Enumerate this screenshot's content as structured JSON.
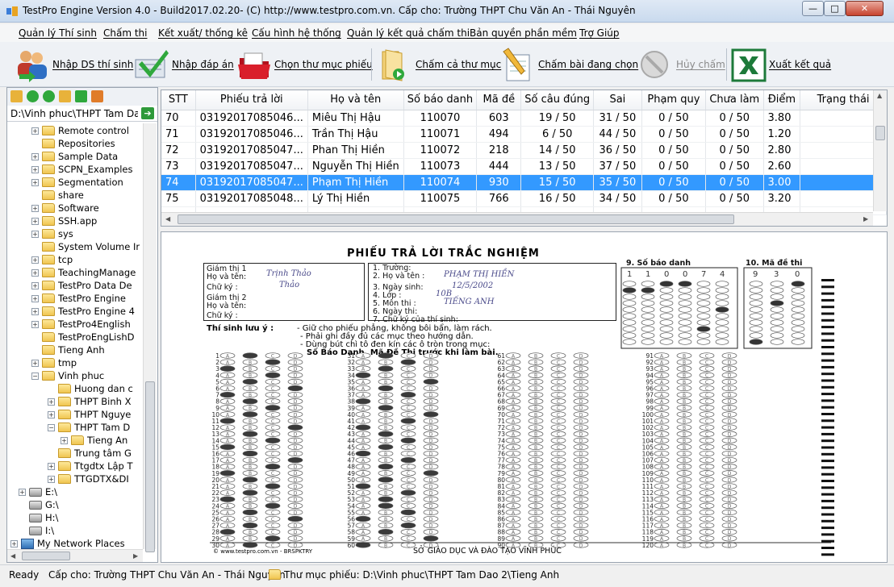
{
  "window": {
    "title": "TestPro Engine Version 4.0 - Build2017.02.20- (C) http://www.testpro.com.vn.  Cấp cho: Trường THPT Chu Văn An - Thái Nguyên",
    "minimize": "—",
    "maximize": "□",
    "close": "✕"
  },
  "menu": [
    "Quản lý Thí sinh",
    "Chấm thi",
    "Kết xuất/ thống kê",
    "Cấu hình hệ thống",
    "Quản lý kết quả chấm thi",
    "Bản quyền phần mềm",
    "Trợ Giúp"
  ],
  "toolbar": [
    {
      "label": "Nhập DS thí sinh",
      "icon": "users-import-icon",
      "enabled": true
    },
    {
      "label": "Nhập đáp án",
      "icon": "checkmark-document-icon",
      "enabled": true
    },
    {
      "label": "Chọn thư mục phiếu",
      "icon": "red-folder-icon",
      "enabled": true
    },
    {
      "label": "Chấm cả thư mục",
      "icon": "folder-play-icon",
      "enabled": true
    },
    {
      "label": "Chấm bài đang chọn",
      "icon": "pencil-sheet-icon",
      "enabled": true
    },
    {
      "label": "Hủy chấm",
      "icon": "cancel-icon",
      "enabled": false
    },
    {
      "label": "Xuất kết quả",
      "icon": "excel-icon",
      "enabled": true
    }
  ],
  "explorer": {
    "path": "D:\\Vinh phuc\\THPT Tam Dao 2",
    "go_label": "➔",
    "tree": [
      {
        "label": "Remote control",
        "level": 1,
        "exp": "+",
        "type": "folder"
      },
      {
        "label": "Repositories",
        "level": 1,
        "exp": "",
        "type": "folder"
      },
      {
        "label": "Sample Data",
        "level": 1,
        "exp": "+",
        "type": "folder"
      },
      {
        "label": "SCPN_Examples",
        "level": 1,
        "exp": "+",
        "type": "folder"
      },
      {
        "label": "Segmentation",
        "level": 1,
        "exp": "+",
        "type": "folder"
      },
      {
        "label": "share",
        "level": 1,
        "exp": "",
        "type": "folder"
      },
      {
        "label": "Software",
        "level": 1,
        "exp": "+",
        "type": "folder"
      },
      {
        "label": "SSH.app",
        "level": 1,
        "exp": "+",
        "type": "folder"
      },
      {
        "label": "sys",
        "level": 1,
        "exp": "+",
        "type": "folder"
      },
      {
        "label": "System Volume Ir",
        "level": 1,
        "exp": "",
        "type": "folder"
      },
      {
        "label": "tcp",
        "level": 1,
        "exp": "+",
        "type": "folder"
      },
      {
        "label": "TeachingManage",
        "level": 1,
        "exp": "+",
        "type": "folder"
      },
      {
        "label": "TestPro Data De",
        "level": 1,
        "exp": "+",
        "type": "folder"
      },
      {
        "label": "TestPro Engine",
        "level": 1,
        "exp": "+",
        "type": "folder"
      },
      {
        "label": "TestPro Engine 4",
        "level": 1,
        "exp": "+",
        "type": "folder"
      },
      {
        "label": "TestPro4English",
        "level": 1,
        "exp": "+",
        "type": "folder"
      },
      {
        "label": "TestProEngLishD",
        "level": 1,
        "exp": "",
        "type": "folder"
      },
      {
        "label": "Tieng Anh",
        "level": 1,
        "exp": "",
        "type": "folder"
      },
      {
        "label": "tmp",
        "level": 1,
        "exp": "+",
        "type": "folder"
      },
      {
        "label": "Vinh phuc",
        "level": 1,
        "exp": "−",
        "type": "folder"
      },
      {
        "label": "Huong dan c",
        "level": 2,
        "exp": "",
        "type": "folder"
      },
      {
        "label": "THPT Binh X",
        "level": 2,
        "exp": "+",
        "type": "folder"
      },
      {
        "label": "THPT Nguye",
        "level": 2,
        "exp": "+",
        "type": "folder"
      },
      {
        "label": "THPT Tam D",
        "level": 2,
        "exp": "−",
        "type": "folder"
      },
      {
        "label": "Tieng An",
        "level": 3,
        "exp": "+",
        "type": "folder"
      },
      {
        "label": "Trung tâm G",
        "level": 2,
        "exp": "",
        "type": "folder"
      },
      {
        "label": "Ttgdtx Lập T",
        "level": 2,
        "exp": "+",
        "type": "folder"
      },
      {
        "label": "TTGDTX&DI",
        "level": 2,
        "exp": "+",
        "type": "folder"
      },
      {
        "label": "E:\\",
        "level": 0,
        "exp": "+",
        "type": "drive"
      },
      {
        "label": "G:\\",
        "level": 0,
        "exp": "",
        "type": "drive"
      },
      {
        "label": "H:\\",
        "level": 0,
        "exp": "",
        "type": "drive"
      },
      {
        "label": "I:\\",
        "level": 0,
        "exp": "",
        "type": "drive"
      },
      {
        "label": "My Network Places",
        "level": -1,
        "exp": "+",
        "type": "network"
      }
    ]
  },
  "results": {
    "columns": [
      "STT",
      "Phiếu trả lời",
      "Họ và tên",
      "Số báo danh",
      "Mã đề",
      "Số câu đúng",
      "Sai",
      "Phạm quy",
      "Chưa làm",
      "Điểm",
      "Trạng thái"
    ],
    "rows": [
      [
        "70",
        "03192017085046...",
        "Miêu Thị Hậu",
        "110070",
        "603",
        "19 / 50",
        "31 / 50",
        "0 / 50",
        "0 / 50",
        "3.80",
        ""
      ],
      [
        "71",
        "03192017085046...",
        "Trần Thị Hậu",
        "110071",
        "494",
        "6 / 50",
        "44 / 50",
        "0 / 50",
        "0 / 50",
        "1.20",
        ""
      ],
      [
        "72",
        "03192017085047...",
        "Phan Thị Hiền",
        "110072",
        "218",
        "14 / 50",
        "36 / 50",
        "0 / 50",
        "0 / 50",
        "2.80",
        ""
      ],
      [
        "73",
        "03192017085047...",
        "Nguyễn Thị Hiền",
        "110073",
        "444",
        "13 / 50",
        "37 / 50",
        "0 / 50",
        "0 / 50",
        "2.60",
        ""
      ],
      [
        "74",
        "03192017085047...",
        "Phạm Thị Hiền",
        "110074",
        "930",
        "15 / 50",
        "35 / 50",
        "0 / 50",
        "0 / 50",
        "3.00",
        ""
      ],
      [
        "75",
        "03192017085048...",
        "Lý Thị Hiền",
        "110075",
        "766",
        "16 / 50",
        "34 / 50",
        "0 / 50",
        "0 / 50",
        "3.20",
        ""
      ]
    ],
    "selected_index": 4
  },
  "sheet": {
    "title": "PHIẾU TRẢ LỜI TRẮC NGHIỆM",
    "sbd_label": "9. Số báo danh",
    "made_label": "10. Mã đề thi",
    "sbd_digits": [
      "1",
      "1",
      "0",
      "0",
      "7",
      "4"
    ],
    "made_digits": [
      "9",
      "3",
      "0"
    ],
    "left_box": {
      "gt1": "Giám thị 1",
      "gt1_name": "Họ và tên:",
      "gt1_sign": "Chữ ký :",
      "gt2": "Giám thị 2",
      "gt2_name": "Họ và tên:",
      "gt2_sign": "Chữ ký :",
      "gt1_hand": "Trịnh Thảo",
      "gt1_sign_hand": "Thảo"
    },
    "mid_box": {
      "l1": "1. Trường:",
      "l2": "2. Họ và tên :",
      "l3": "3. Ngày sinh:",
      "l4": "4. Lớp :",
      "l5": "5. Môn thi :",
      "l6": "6. Ngày thi:",
      "l7": "7. Chữ ký của thí sinh:",
      "name_hand": "PHẠM  THỊ  HIỀN",
      "dob_hand": "12/5/2002",
      "class_hand": "10B",
      "subject_hand": "TIẾNG  ANH"
    },
    "notes": {
      "label": "Thí sinh lưu ý :",
      "n1": "- Giữ cho phiếu phẳng, không bôi bẩn, làm rách.",
      "n2": "- Phải ghi đầy đủ các mục theo hướng dẫn.",
      "n3": "- Dùng bút chì tô đen kín các ô tròn trong mục:",
      "n4": "Số Báo Danh, Mã Đề Thi trước khi làm bài."
    },
    "option_letters": [
      "A",
      "B",
      "C",
      "D"
    ],
    "footer_left": "© www.testpro.com.vn - BRSPKTRY",
    "footer_right": "SỞ GIÁO DỤC VÀ ĐÀO TẠO VĨNH PHÚC"
  },
  "status": {
    "ready": "Ready",
    "licensed": "Cấp cho: Trường THPT Chu Văn An - Thái Nguyên",
    "folder": "Thư mục phiếu: D:\\Vinh phuc\\THPT Tam Dao 2\\Tieng Anh"
  },
  "colors": {
    "selection": "#3399ff",
    "excel_green": "#1d7a3a",
    "title_bar": "#c9daee"
  }
}
